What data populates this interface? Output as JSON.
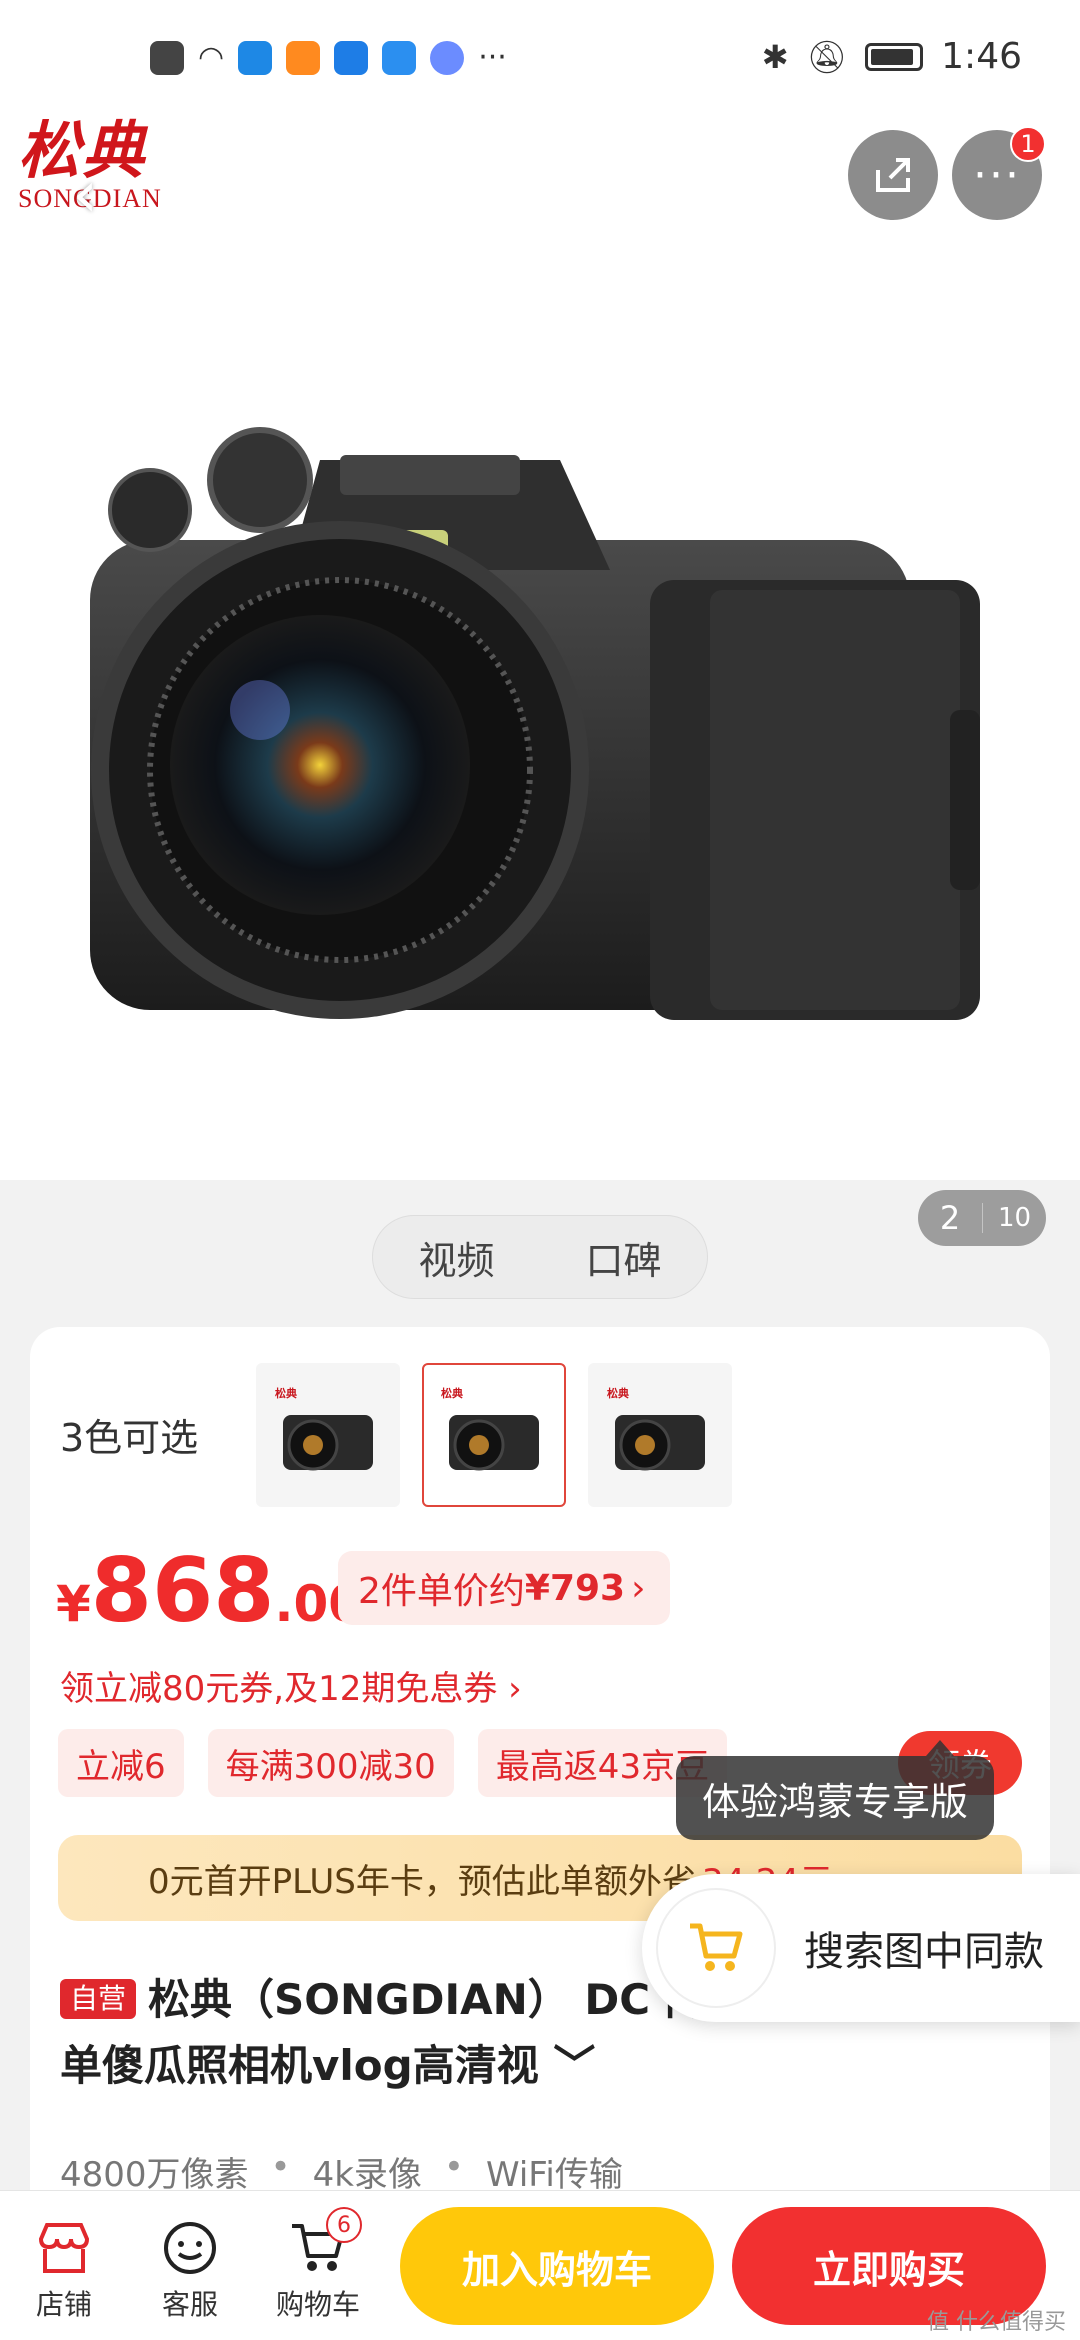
{
  "status_bar": {
    "time": "1:46"
  },
  "brand": {
    "logo_cn": "松典",
    "logo_en": "SONGDIAN"
  },
  "header": {
    "notif_count": "1"
  },
  "gallery": {
    "current": "2",
    "total": "10"
  },
  "media_tabs": [
    "视频",
    "口碑"
  ],
  "variants": {
    "label": "3色可选",
    "brand_mark": "松典"
  },
  "price": {
    "yen": "¥",
    "integer": "868",
    "decimal": ".00",
    "unit_chip_prefix": "2件单价约",
    "unit_chip_value": "¥793",
    "unit_chip_arrow": "›"
  },
  "coupon_line": "领立减80元券,及12期免息券 ›",
  "promo_tags": [
    "立减6",
    "每满300减30",
    "最高返43京豆"
  ],
  "get_coupon_label": "领券",
  "plus_bar": {
    "text": "0元首开PLUS年卡，预估此单额外省",
    "highlight": "34.24元"
  },
  "product": {
    "badge": "自营",
    "title": "松典（SONGDIAN） DC 门级4K单反微单傻瓜照相机vlog高清视 ﹀",
    "features": [
      "4800万像素",
      "4k录像",
      "WiFi传输"
    ]
  },
  "tooltip": "体验鸿蒙专享版",
  "image_search_label": "搜索图中同款",
  "bottom_nav": [
    {
      "label": "店铺",
      "icon": "store-icon"
    },
    {
      "label": "客服",
      "icon": "customer-service-icon"
    },
    {
      "label": "购物车",
      "icon": "cart-icon",
      "badge": "6"
    }
  ],
  "actions": {
    "add_to_cart": "加入购物车",
    "buy_now": "立即购买"
  },
  "watermark": "值 什么值得买",
  "colors": {
    "red": "#f23030",
    "yellow": "#ffc80a",
    "brand_red": "#d0161b"
  }
}
